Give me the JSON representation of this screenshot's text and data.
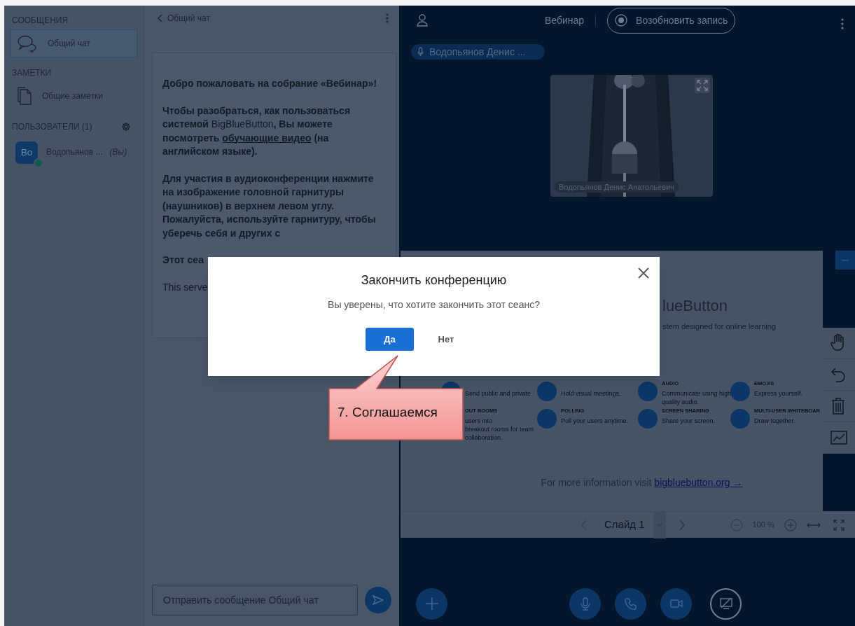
{
  "sidebar": {
    "sections": [
      {
        "title": "СООБЩЕНИЯ",
        "items": [
          {
            "kind": "chat",
            "label": "Общий чат",
            "selected": true
          }
        ]
      },
      {
        "title": "ЗАМЕТКИ",
        "items": [
          {
            "kind": "notes",
            "label": "Общие заметки",
            "selected": false
          }
        ]
      }
    ],
    "users_header": "ПОЛЬЗОВАТЕЛИ (1)",
    "users": [
      {
        "avatar": "Bo",
        "name": "Водопьянов ...",
        "you_label": "(Вы)"
      }
    ]
  },
  "chat": {
    "title": "Общий чат",
    "paragraphs": [
      [
        {
          "kind": "bold",
          "text": "Добро пожаловать на собрание «"
        },
        {
          "kind": "strong",
          "text": "Вебинар"
        },
        {
          "kind": "bold",
          "text": "»!"
        }
      ],
      [
        {
          "kind": "bold",
          "text": "Чтобы разобраться, как пользоваться системой "
        },
        {
          "kind": "plain",
          "text": "BigBlueButton"
        },
        {
          "kind": "bold",
          "text": ", Вы можете посмотреть "
        },
        {
          "kind": "link",
          "text": "обучающие видео"
        },
        {
          "kind": "bold",
          "text": " (на английском языке)."
        }
      ],
      [
        {
          "kind": "bold",
          "text": "Для участия в аудиоконференции нажмите на изображение головной гарнитуры (наушников) в верхнем левом углу. "
        },
        {
          "kind": "strong",
          "text": "Пожалуйста, используйте гарнитуру, чтобы уберечь себя и других с"
        }
      ],
      [
        {
          "kind": "bold",
          "text": "Этот сеа"
        }
      ],
      [
        {
          "kind": "plain",
          "text": "This serve"
        }
      ]
    ],
    "input": {
      "placeholder": "Отправить сообщение Общий чат"
    }
  },
  "meeting": {
    "title": "Вебинар",
    "record_button": "Возобновить запись",
    "talking": "Водопьянов Денис ...",
    "video_name": "Водопьянов Денис Анатольевич"
  },
  "slide": {
    "heading": "lueButton",
    "subtitle": "stem designed for online learning",
    "features": [
      {
        "icon": true,
        "desc": [
          "Send public and private"
        ]
      },
      {
        "icon": true,
        "desc": [
          "Hold visual meetings."
        ]
      },
      {
        "icon": true,
        "title": "AUDIO",
        "desc": [
          "Communicate using high",
          "quality audio."
        ]
      },
      {
        "icon": true,
        "title": "EMOJIS",
        "desc": [
          "Express yourself."
        ]
      },
      {
        "icon": false,
        "title": "OUT ROOMS",
        "desc": [
          "users into",
          "breakout rooms for team",
          "collaboration."
        ]
      },
      {
        "icon": true,
        "title": "POLLING",
        "desc": [
          "Poll your users anytime."
        ]
      },
      {
        "icon": true,
        "title": "SCREEN SHARING",
        "desc": [
          "Share your screen."
        ]
      },
      {
        "icon": true,
        "title": "MULTI-USER WHITEBOAR",
        "desc": [
          "Draw together."
        ]
      }
    ],
    "footer_text": "For more information visit ",
    "footer_link": "bigbluebutton.org →"
  },
  "slide_toolbar": {
    "slide_label": "Слайд 1",
    "zoom": "100 %"
  },
  "dialog": {
    "title": "Закончить конференцию",
    "message": "Вы уверены, что хотите закончить этот сеанс?",
    "confirm": "Да",
    "cancel": "Нет"
  },
  "callout": {
    "text": "7. Соглашаемся"
  }
}
